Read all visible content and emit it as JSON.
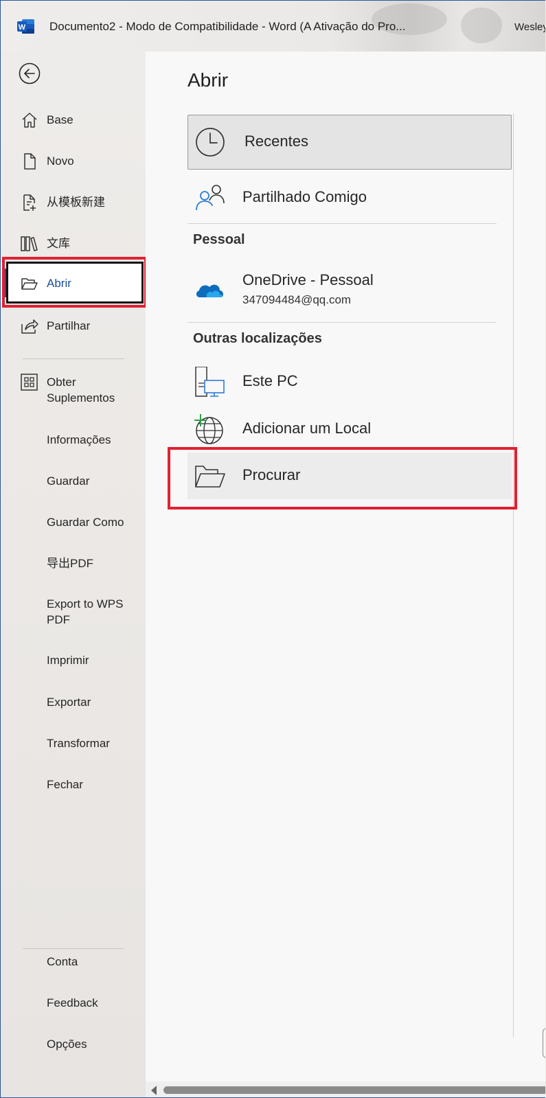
{
  "titlebar": {
    "title": "Documento2  -  Modo de Compatibilidade  -  Word (A Ativação do Pro...",
    "user": "Wesley"
  },
  "sidebar": {
    "items": [
      {
        "label": "Base",
        "icon": "home-icon"
      },
      {
        "label": "Novo",
        "icon": "new-document-icon"
      },
      {
        "label": "从模板新建",
        "icon": "template-icon"
      },
      {
        "label": "文库",
        "icon": "library-icon"
      },
      {
        "label": "Abrir",
        "icon": "open-folder-icon",
        "active": true
      },
      {
        "label": "Partilhar",
        "icon": "share-icon"
      },
      {
        "label": "Obter\nSuplementos",
        "icon": "addins-icon"
      },
      {
        "label": "Informações"
      },
      {
        "label": "Guardar"
      },
      {
        "label": "Guardar Como"
      },
      {
        "label": "导出PDF"
      },
      {
        "label": "Export to WPS\nPDF"
      },
      {
        "label": "Imprimir"
      },
      {
        "label": "Exportar"
      },
      {
        "label": "Transformar"
      },
      {
        "label": "Fechar"
      }
    ],
    "bottom_items": [
      {
        "label": "Conta"
      },
      {
        "label": "Feedback"
      },
      {
        "label": "Opções"
      }
    ]
  },
  "main": {
    "title": "Abrir",
    "recent_label": "Recentes",
    "shared_label": "Partilhado Comigo",
    "personal_header": "Pessoal",
    "onedrive_label": "OneDrive - Pessoal",
    "onedrive_account": "347094484@qq.com",
    "other_header": "Outras localizações",
    "thispc_label": "Este PC",
    "addplace_label": "Adicionar um Local",
    "browse_label": "Procurar"
  },
  "colors": {
    "accent": "#1e4e9a",
    "highlight_box": "#e02130",
    "word_blue": "#185abd"
  }
}
